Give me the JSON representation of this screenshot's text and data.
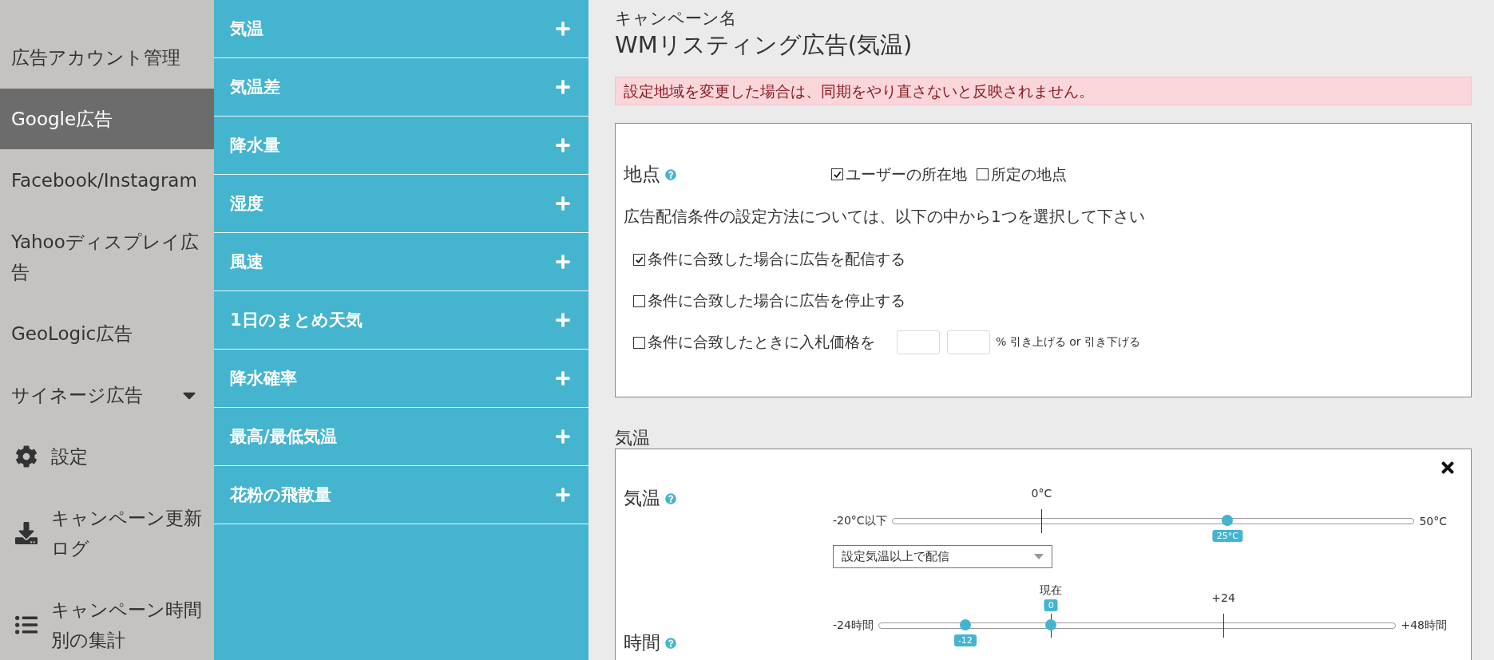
{
  "sidebar": {
    "items": [
      {
        "label": "広告アカウント管理",
        "selected": false,
        "kind": "plain"
      },
      {
        "label": "Google広告",
        "selected": true,
        "kind": "plain"
      },
      {
        "label": "Facebook/Instagram",
        "selected": false,
        "kind": "plain"
      },
      {
        "label": "Yahooディスプレイ広告",
        "selected": false,
        "kind": "plain"
      },
      {
        "label": "GeoLogic広告",
        "selected": false,
        "kind": "plain"
      },
      {
        "label": "サイネージ広告",
        "selected": false,
        "kind": "dropdown"
      },
      {
        "label": "設定",
        "selected": false,
        "kind": "settings"
      },
      {
        "label": "キャンペーン更新ログ",
        "selected": false,
        "kind": "download"
      },
      {
        "label": "キャンペーン時間別の集計",
        "selected": false,
        "kind": "list"
      }
    ]
  },
  "categories": [
    {
      "label": "気温"
    },
    {
      "label": "気温差"
    },
    {
      "label": "降水量"
    },
    {
      "label": "湿度"
    },
    {
      "label": "風速"
    },
    {
      "label": "1日のまとめ天気"
    },
    {
      "label": "降水確率"
    },
    {
      "label": "最高/最低気温"
    },
    {
      "label": "花粉の飛散量"
    }
  ],
  "campaign": {
    "caption": "キャンペーン名",
    "name": "WMリスティング広告(気温)"
  },
  "alert": "設定地域を変更した場合は、同期をやり直さないと反映されません。",
  "settings_card": {
    "location": {
      "label": "地点",
      "options": [
        {
          "label": "ユーザーの所在地",
          "checked": true
        },
        {
          "label": "所定の地点",
          "checked": false
        }
      ]
    },
    "instruction": "広告配信条件の設定方法については、以下の中から1つを選択して下さい",
    "conditions": [
      {
        "kind": "plain",
        "label": "条件に合致した場合に広告を配信する",
        "checked": true
      },
      {
        "kind": "plain",
        "label": "条件に合致した場合に広告を停止する",
        "checked": false
      },
      {
        "kind": "bid",
        "label": "条件に合致したときに入札価格を",
        "checked": false,
        "suffix": "% 引き上げる or 引き下げる"
      }
    ]
  },
  "condition_section": {
    "title": "気温",
    "rows": [
      {
        "label": "気温",
        "min_label": "-20°C以下",
        "max_label": "50°C",
        "ticks": [
          "0°C"
        ],
        "thumbs": [
          {
            "value": "25°C",
            "level": 0.643,
            "kind": "below"
          }
        ],
        "select": "設定気温以上で配信"
      },
      {
        "label": "時間",
        "min_label": "-24時間",
        "max_label": "+48時間",
        "ticks": [
          "現在",
          "+24"
        ],
        "thumbs": [
          {
            "value": "-12",
            "level": 0.167,
            "kind": "below"
          },
          {
            "value": "0",
            "level": 0.333,
            "kind": "above"
          }
        ]
      }
    ]
  }
}
